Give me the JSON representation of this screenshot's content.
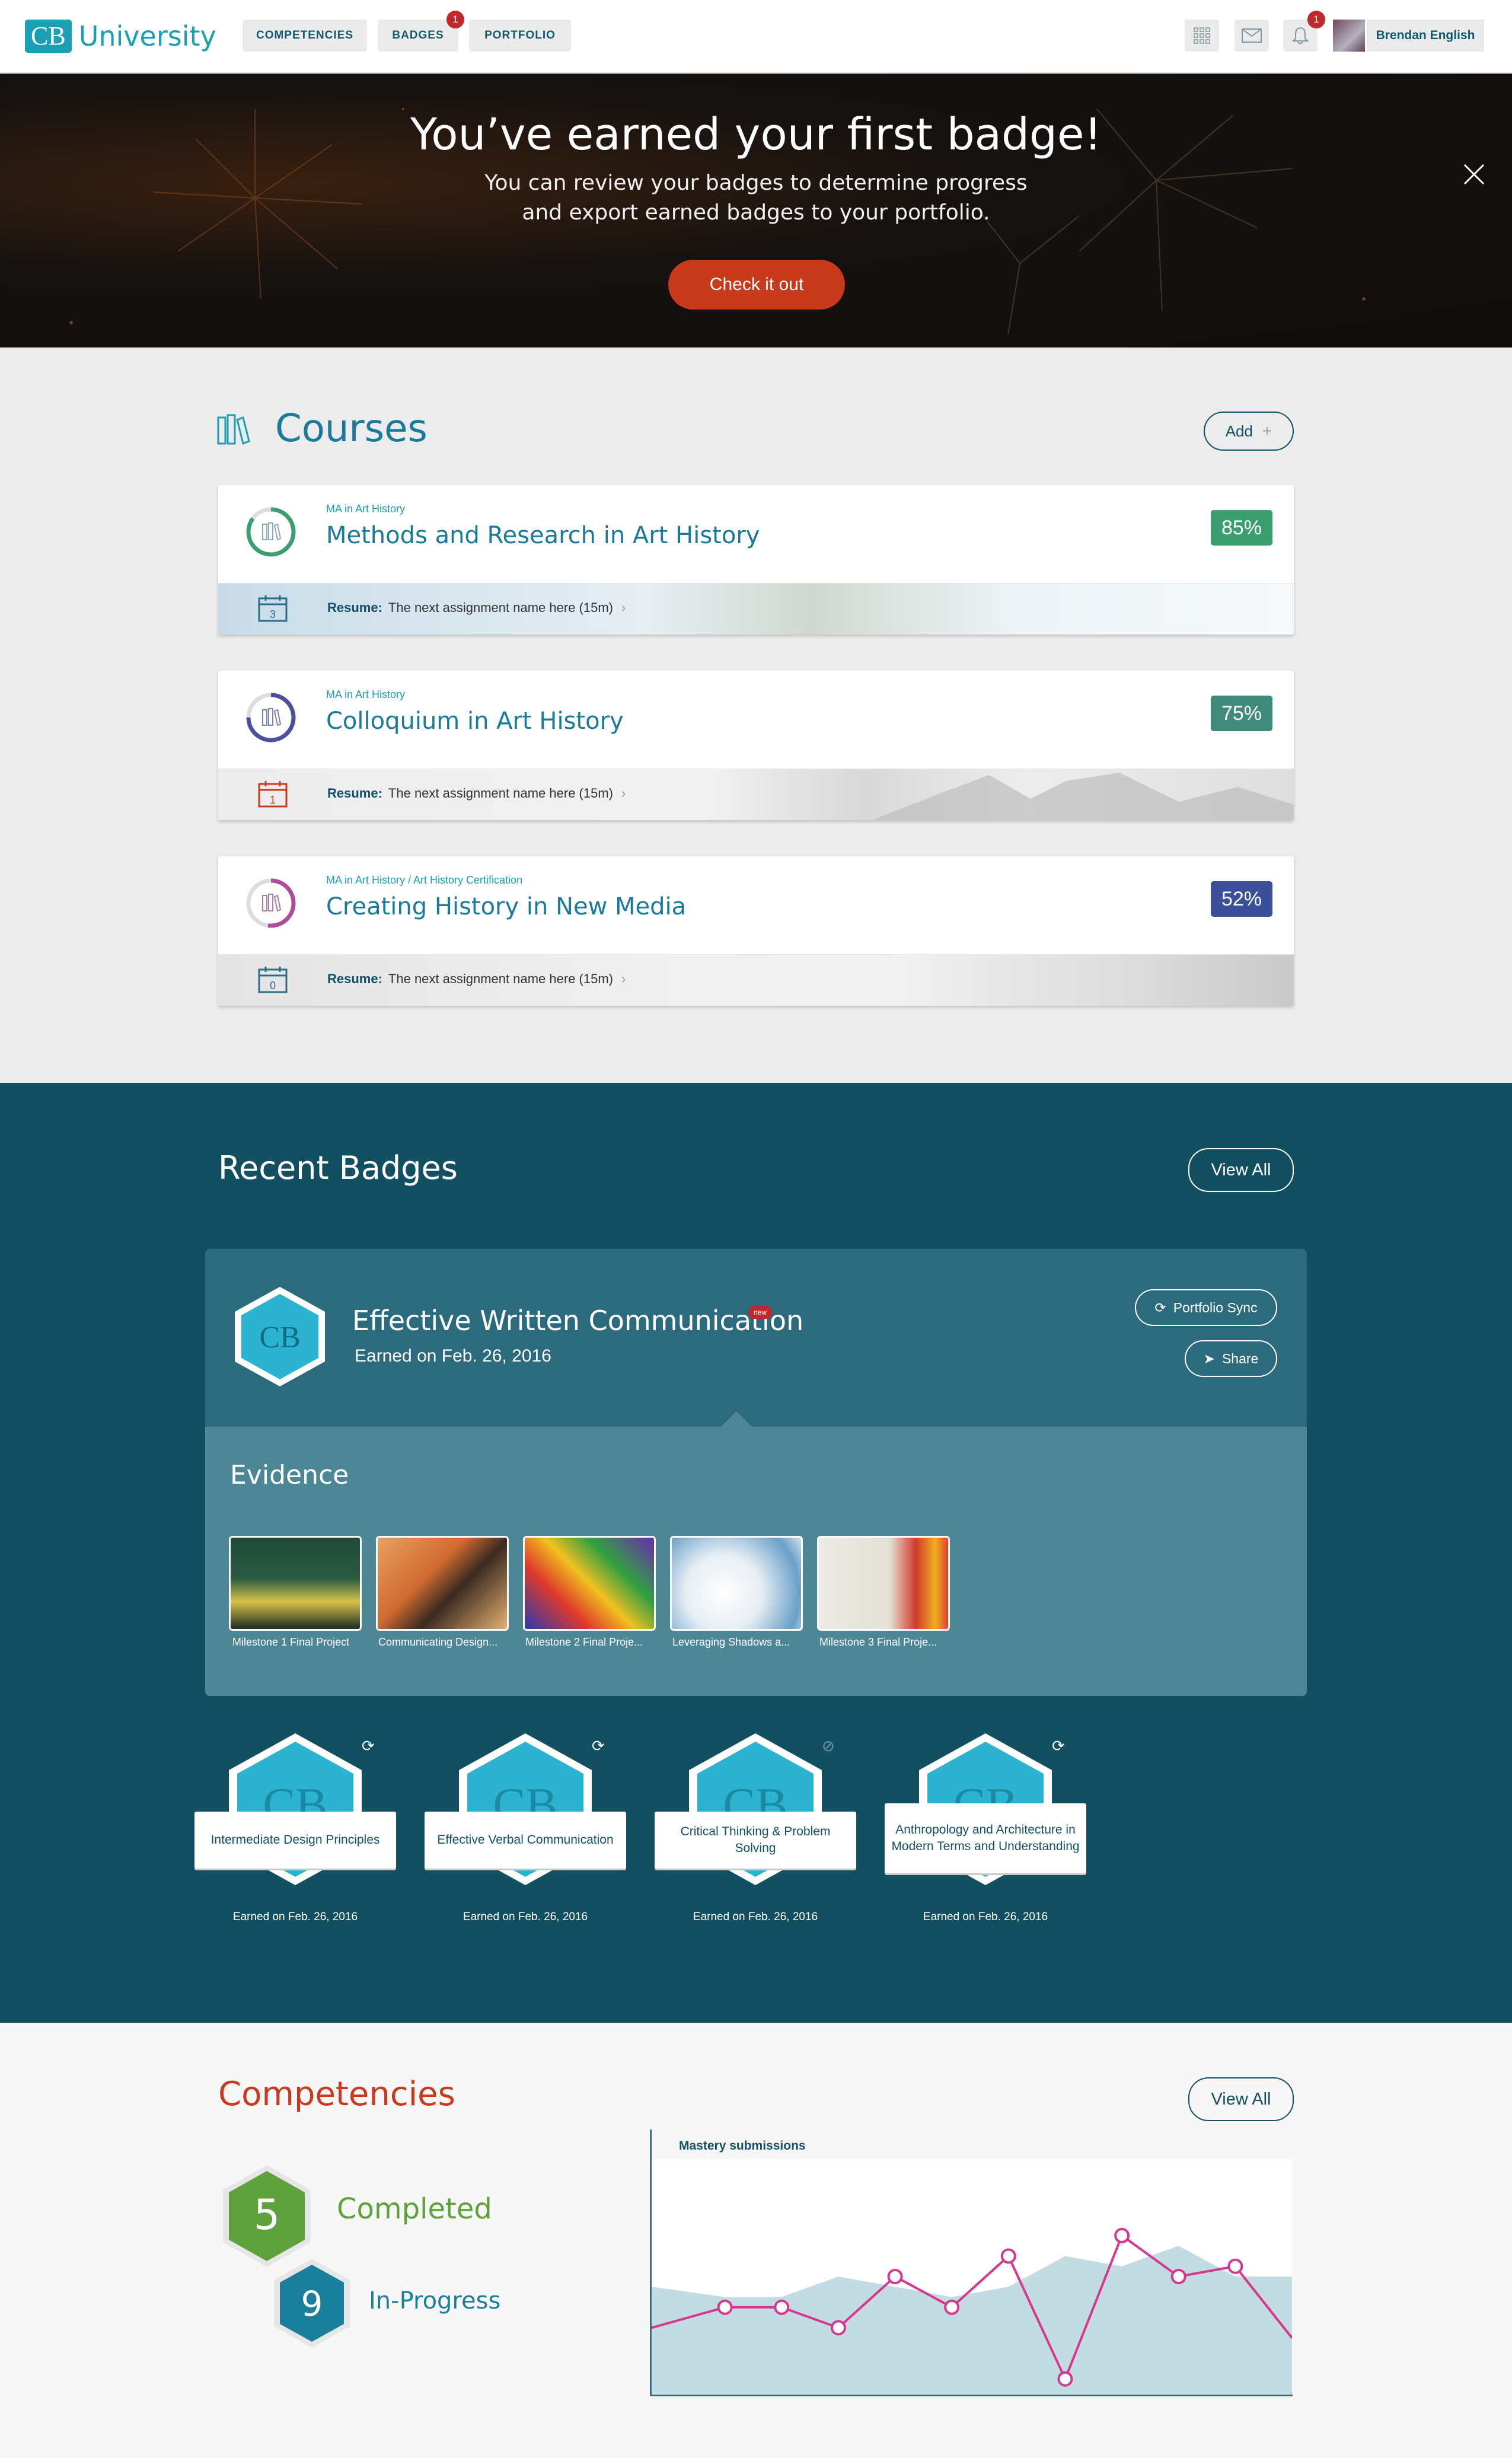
{
  "nav": {
    "logo_box": "CB",
    "logo_word": "University",
    "tabs": [
      {
        "label": "COMPETENCIES"
      },
      {
        "label": "BADGES",
        "count": "1"
      },
      {
        "label": "PORTFOLIO"
      }
    ],
    "icons": [
      "apps-grid-icon",
      "mail-icon",
      "bell-icon"
    ],
    "notification_count": "1",
    "user_name": "Brendan English"
  },
  "hero": {
    "title": "You’ve earned your first badge!",
    "subtitle_line1": "You can review your badges to determine progress",
    "subtitle_line2": "and export earned badges to your portfolio.",
    "cta": "Check it out"
  },
  "courses": {
    "title": "Courses",
    "add_label": "Add",
    "resume_label": "Resume:",
    "items": [
      {
        "program": "MA in Art History",
        "title": "Methods and Research in Art History",
        "percent": "85%",
        "progress": 0.85,
        "calendar_day": "3",
        "resume_text": "The next assignment name here (15m)",
        "color": "#3a9e6e"
      },
      {
        "program": "MA in Art History",
        "title": "Colloquium in Art History",
        "percent": "75%",
        "progress": 0.75,
        "calendar_day": "1",
        "resume_text": "The next assignment name here (15m)",
        "color": "#3f8a7a"
      },
      {
        "program": "MA in Art History / Art History Certification",
        "title": "Creating History in New Media",
        "percent": "52%",
        "progress": 0.52,
        "calendar_day": "0",
        "resume_text": "The next assignment name here (15m)",
        "color": "#3b4f9a"
      }
    ]
  },
  "badges": {
    "title": "Recent Badges",
    "view_all": "View All",
    "featured": {
      "logo": "CB",
      "title": "Effective Written Communication",
      "new_tag": "new",
      "earned": "Earned on Feb. 26, 2016",
      "portfolio_sync": "Portfolio Sync",
      "share": "Share"
    },
    "evidence_title": "Evidence",
    "evidence": [
      {
        "label": "Milestone 1 Final Project"
      },
      {
        "label": "Communicating Design..."
      },
      {
        "label": "Milestone 2 Final Proje..."
      },
      {
        "label": "Leveraging Shadows a..."
      },
      {
        "label": "Milestone 3 Final Proje..."
      }
    ],
    "items": [
      {
        "title": "Intermediate Design Principles",
        "earned": "Earned on Feb. 26, 2016",
        "status_icon": "sync-icon"
      },
      {
        "title": "Effective Verbal Communication",
        "earned": "Earned on Feb. 26, 2016",
        "status_icon": "sync-icon"
      },
      {
        "title": "Critical Thinking & Problem Solving",
        "earned": "Earned on Feb. 26, 2016",
        "status_icon": "no-sync-icon"
      },
      {
        "title": "Anthropology and Architecture in Modern Terms and Understanding",
        "earned": "Earned on Feb. 26, 2016",
        "status_icon": "sync-icon"
      }
    ]
  },
  "competencies": {
    "title": "Competencies",
    "view_all": "View All",
    "completed_count": "5",
    "completed_label": "Completed",
    "inprogress_count": "9",
    "inprogress_label": "In-Progress",
    "chart_data": {
      "type": "line",
      "title": "Mastery submissions",
      "xlabel": "",
      "ylabel": "",
      "series": [
        {
          "values": [
            6,
            8,
            8,
            6,
            11,
            8,
            13,
            1,
            15,
            11,
            12,
            5
          ]
        }
      ],
      "area_values": [
        10,
        9,
        9,
        11,
        10,
        9,
        10,
        13,
        12,
        14,
        11,
        11
      ],
      "grid": false
    }
  },
  "colors": {
    "teal": "#1a9fb3",
    "navy": "#124f61",
    "orange": "#c9391b",
    "pink": "#d4398f",
    "area": "#c3dbe2"
  }
}
